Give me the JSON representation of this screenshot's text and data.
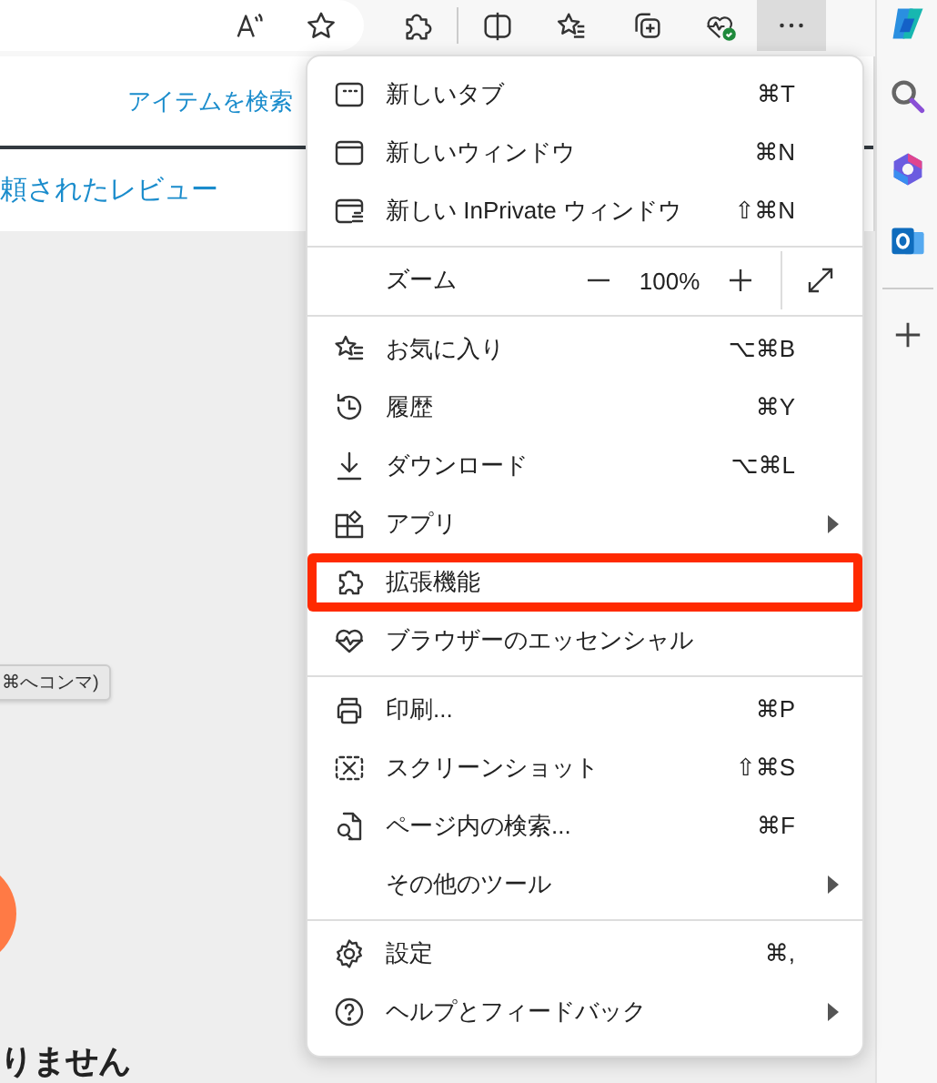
{
  "toolbar": {
    "menu_button": {
      "pressed": true
    }
  },
  "page": {
    "search_link": "アイテムを検索",
    "reviews_link": "頼されたレビュー",
    "tooltip": "⌘へコンマ)",
    "heading": "りません"
  },
  "menu": {
    "items": [
      {
        "kind": "item",
        "label": "新しいタブ",
        "shortcut": "⌘T",
        "submenu": false,
        "highlighted": false
      },
      {
        "kind": "item",
        "label": "新しいウィンドウ",
        "shortcut": "⌘N",
        "submenu": false,
        "highlighted": false
      },
      {
        "kind": "item",
        "label": "新しい InPrivate ウィンドウ",
        "shortcut": "⇧⌘N",
        "submenu": false,
        "highlighted": false
      },
      {
        "kind": "divider"
      },
      {
        "kind": "zoom",
        "label": "ズーム",
        "value": "100%"
      },
      {
        "kind": "divider"
      },
      {
        "kind": "item",
        "label": "お気に入り",
        "shortcut": "⌥⌘B",
        "submenu": false,
        "highlighted": false
      },
      {
        "kind": "item",
        "label": "履歴",
        "shortcut": "⌘Y",
        "submenu": false,
        "highlighted": false
      },
      {
        "kind": "item",
        "label": "ダウンロード",
        "shortcut": "⌥⌘L",
        "submenu": false,
        "highlighted": false
      },
      {
        "kind": "item",
        "label": "アプリ",
        "submenu": true,
        "highlighted": false
      },
      {
        "kind": "item",
        "label": "拡張機能",
        "submenu": false,
        "highlighted": true
      },
      {
        "kind": "item",
        "label": "ブラウザーのエッセンシャル",
        "submenu": false,
        "highlighted": false
      },
      {
        "kind": "divider"
      },
      {
        "kind": "item",
        "label": "印刷...",
        "shortcut": "⌘P",
        "submenu": false,
        "highlighted": false
      },
      {
        "kind": "item",
        "label": "スクリーンショット",
        "shortcut": "⇧⌘S",
        "submenu": false,
        "highlighted": false
      },
      {
        "kind": "item",
        "label": "ページ内の検索...",
        "shortcut": "⌘F",
        "submenu": false,
        "highlighted": false
      },
      {
        "kind": "item",
        "label": "その他のツール",
        "submenu": true,
        "highlighted": false
      },
      {
        "kind": "divider"
      },
      {
        "kind": "item",
        "label": "設定",
        "shortcut": "⌘,",
        "submenu": false,
        "highlighted": false
      },
      {
        "kind": "item",
        "label": "ヘルプとフィードバック",
        "submenu": true,
        "highlighted": false
      }
    ]
  }
}
